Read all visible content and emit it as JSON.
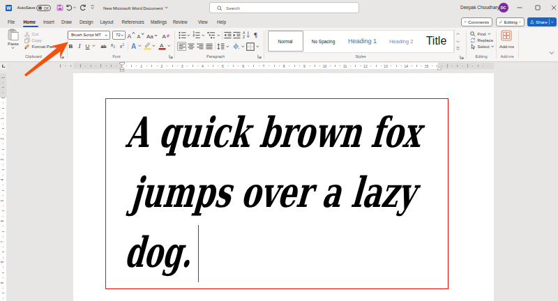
{
  "titlebar": {
    "app_logo_letter": "W",
    "autosave_label": "AutoSave",
    "autosave_state": "Off",
    "document_title": "New Microsoft Word Document",
    "search_placeholder": "Search",
    "user_name": "Deepak Choudhary",
    "user_initials": "DC"
  },
  "tabs": {
    "items": [
      "File",
      "Home",
      "Insert",
      "Draw",
      "Design",
      "Layout",
      "References",
      "Mailings",
      "Review",
      "View",
      "Help"
    ],
    "active": "Home"
  },
  "tab_actions": {
    "comments": "Comments",
    "editing": "Editing",
    "share": "Share"
  },
  "ribbon": {
    "clipboard": {
      "label": "Clipboard",
      "paste": "Paste",
      "cut": "Cut",
      "copy": "Copy",
      "format_painter": "Format Painter"
    },
    "font": {
      "label": "Font",
      "font_name": "Brush Script MT",
      "font_size": "72",
      "grow": "A",
      "shrink": "A",
      "clear": "A",
      "bold": "B",
      "italic": "I",
      "underline": "U",
      "strikethrough": "ab",
      "subscript": "x",
      "subscript_sub": "2",
      "superscript": "x",
      "superscript_sup": "2",
      "change_case": "Aa",
      "text_effect": "A",
      "font_color": "A"
    },
    "paragraph": {
      "label": "Paragraph",
      "pilcrow": "¶",
      "sort_a": "A",
      "sort_z": "Z"
    },
    "styles": {
      "label": "Styles",
      "items": [
        "Normal",
        "No Spacing",
        "Heading 1",
        "Heading 2",
        "Title"
      ],
      "selected": "Normal"
    },
    "editing": {
      "label": "Editing",
      "find": "Find",
      "replace": "Replace",
      "select": "Select"
    },
    "addins": {
      "label": "Add-ins",
      "button": "Add-ins"
    }
  },
  "ruler": {
    "h_numbers": [
      "1",
      "2",
      "3",
      "4",
      "5",
      "6",
      "7",
      "8",
      "9",
      "10",
      "11",
      "12",
      "13",
      "14",
      "15"
    ],
    "v_numbers": [
      "1",
      "2",
      "3",
      "4",
      "5",
      "6",
      "7",
      "8",
      "9"
    ]
  },
  "document": {
    "text_lines": [
      "A quick brown fox",
      "jumps over a lazy",
      "dog."
    ]
  },
  "colors": {
    "accent_blue": "#185abd",
    "share_button": "#1966c2",
    "heading_blue": "#2e74b5",
    "arrow_annotation": "#f4520e",
    "textbox_border": "#ee0b0b",
    "save_icon": "#b14fc9",
    "avatar_bg": "#7d2a9e",
    "highlight_yellow": "#ffe81a",
    "font_color_red": "#e81b1b",
    "addins_orange": "#d35230"
  }
}
